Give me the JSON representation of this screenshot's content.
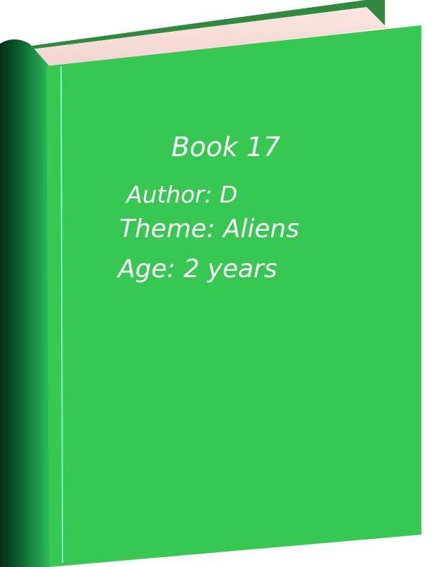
{
  "book": {
    "title": "Book 17",
    "author": "Author: D",
    "theme": "Theme: Aliens",
    "age": "Age: 2 years"
  },
  "colors": {
    "cover": "#37c853",
    "cover_back": "#2b7a3a",
    "spine_dark": "#05341a",
    "spine_mid": "#1f8c4a",
    "pages": "#f5dcd8",
    "spine_line": "#6ff0c0",
    "text": "#ffffff"
  }
}
